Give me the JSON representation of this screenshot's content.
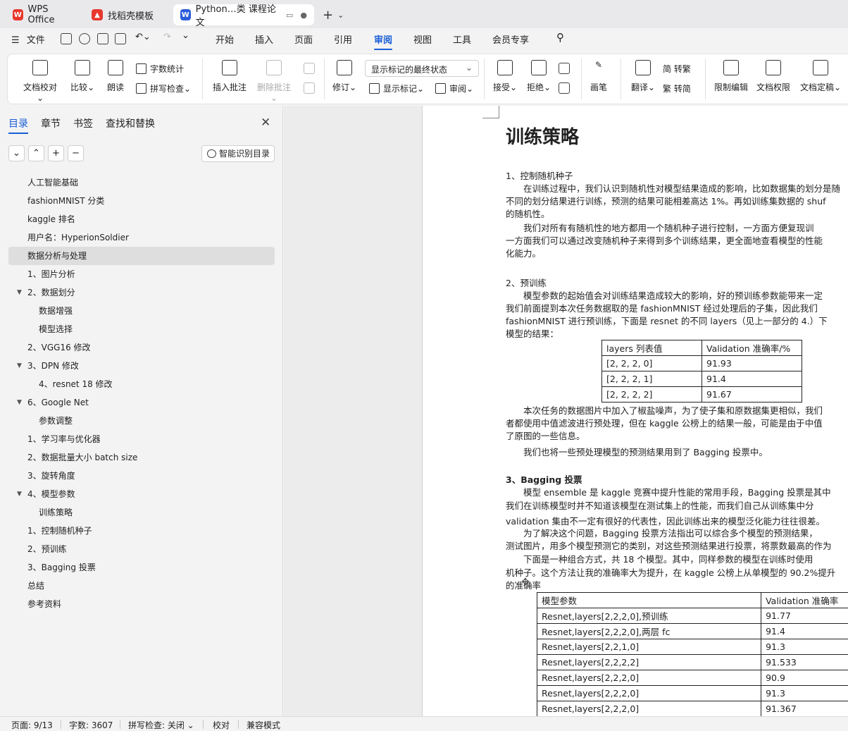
{
  "tabs": [
    {
      "label": "WPS Office",
      "icon": "wps-logo-icon",
      "color": "#e8372c"
    },
    {
      "label": "找稻壳模板",
      "icon": "docer-icon",
      "color": "#e8372c"
    },
    {
      "label": "Python…类 课程论文",
      "icon": "word-doc-icon",
      "color": "#2b5cd9"
    }
  ],
  "menu": {
    "file": "文件",
    "items": [
      "开始",
      "插入",
      "页面",
      "引用",
      "审阅",
      "视图",
      "工具",
      "会员专享"
    ],
    "active": "审阅"
  },
  "ribbon": {
    "doc_check": "文档校对",
    "compare": "比较",
    "read_aloud": "朗读",
    "word_count": "字数统计",
    "spell_check": "拼写检查",
    "insert_comment": "插入批注",
    "delete_comment": "删除批注",
    "track_changes": "修订",
    "markup_state": "显示标记的最终状态",
    "show_markup": "显示标记",
    "review": "审阅",
    "accept": "接受",
    "reject": "拒绝",
    "pen": "画笔",
    "translate": "翻译",
    "to_traditional": "简 转繁",
    "to_simplified": "繁 转简",
    "restrict_edit": "限制编辑",
    "doc_permission": "文档权限",
    "doc_finalize": "文档定稿"
  },
  "nav": {
    "tabs": [
      "目录",
      "章节",
      "书签",
      "查找和替换"
    ],
    "active_tab": "目录",
    "smart_toc": "智能识别目录",
    "toc": [
      {
        "label": "人工智能基础",
        "level": 1
      },
      {
        "label": "fashionMNIST 分类",
        "level": 1
      },
      {
        "label": "kaggle 排名",
        "level": 1
      },
      {
        "label": "用户名：HyperionSoldier",
        "level": 1
      },
      {
        "label": "数据分析与处理",
        "level": 1,
        "selected": true
      },
      {
        "label": "1、图片分析",
        "level": 1
      },
      {
        "label": "2、数据划分",
        "level": 1,
        "expanded": true
      },
      {
        "label": "数据增强",
        "level": 2
      },
      {
        "label": "模型选择",
        "level": 2
      },
      {
        "label": "2、VGG16 修改",
        "level": 1
      },
      {
        "label": "3、DPN 修改",
        "level": 1,
        "expanded": true
      },
      {
        "label": "4、resnet 18 修改",
        "level": 2
      },
      {
        "label": "6、Google Net",
        "level": 1,
        "expanded": true
      },
      {
        "label": "参数调整",
        "level": 2
      },
      {
        "label": "1、学习率与优化器",
        "level": 1
      },
      {
        "label": "2、数据批量大小 batch size",
        "level": 1
      },
      {
        "label": "3、旋转角度",
        "level": 1
      },
      {
        "label": "4、模型参数",
        "level": 1,
        "expanded": true
      },
      {
        "label": "训练策略",
        "level": 2
      },
      {
        "label": "1、控制随机种子",
        "level": 1
      },
      {
        "label": "2、预训练",
        "level": 1
      },
      {
        "label": "3、Bagging 投票",
        "level": 1
      },
      {
        "label": "总结",
        "level": 1
      },
      {
        "label": "参考资料",
        "level": 1
      }
    ]
  },
  "doc": {
    "title": "训练策略",
    "s1_head": "1、控制随机种子",
    "s1_l1": "　　在训练过程中，我们认识到随机性对模型结果造成的影响，比如数据集的划分是随",
    "s1_l2": "不同的划分结果进行训练，预测的结果可能相差高达 1%。再如训练集数据的 shuf",
    "s1_l3": "的随机性。",
    "s1_l4": "　　我们对所有有随机性的地方都用一个随机种子进行控制，一方面方便复现训",
    "s1_l5": "一方面我们可以通过改变随机种子来得到多个训练结果，更全面地查看模型的性能",
    "s1_l6": "化能力。",
    "s2_head": "2、预训练",
    "s2_l1": "　　模型参数的起始值会对训练结果造成较大的影响，好的预训练参数能带来一定",
    "s2_l2": "我们前面提到本次任务数据取的是 fashionMNIST 经过处理后的子集，因此我们",
    "s2_l3": "fashionMNIST 进行预训练，下面是 resnet 的不同 layers（见上一部分的 4.）下",
    "s2_l4": "模型的结果：",
    "t1_head": [
      "layers 列表值",
      "Validation 准确率/%"
    ],
    "t1_rows": [
      [
        "[2, 2, 2, 0]",
        "91.93"
      ],
      [
        "[2, 2, 2, 1]",
        "91.4"
      ],
      [
        "[2, 2, 2, 2]",
        "91.67"
      ]
    ],
    "s2_l5": "　　本次任务的数据图片中加入了椒盐噪声，为了使子集和原数据集更相似，我们",
    "s2_l6": "者都使用中值滤波进行预处理，但在 kaggle 公榜上的结果一般，可能是由于中值",
    "s2_l7": "了原图的一些信息。",
    "s2_l8": "　　我们也将一些预处理模型的预测结果用到了 Bagging 投票中。",
    "s3_head": "3、Bagging 投票",
    "s3_l1": "　　模型 ensemble 是 kaggle 竞赛中提升性能的常用手段，Bagging 投票是其中",
    "s3_l2": "我们在训练模型时并不知道该模型在测试集上的性能，而我们自己从训练集中分",
    "s3_l3": "validation 集由不一定有很好的代表性，因此训练出来的模型泛化能力往往很差。",
    "s3_l4": "　　为了解决这个问题，Bagging 投票方法指出可以综合多个模型的预测结果，",
    "s3_l5": "测试图片，用多个模型预测它的类别，对这些预测结果进行投票，将票数最高的作为",
    "s3_l6": "　　下面是一种组合方式，共 18 个模型。其中，同样参数的模型在训练时使用",
    "s3_l7": "机种子。这个方法让我的准确率大为提升，在 kaggle 公榜上从单模型的 90.2%提升",
    "s3_l8": "的准确率",
    "t2_head": [
      "模型参数",
      "Validation 准确率"
    ],
    "t2_rows": [
      [
        "Resnet,layers[2,2,2,0],预训练",
        "91.77"
      ],
      [
        "Resnet,layers[2,2,2,0],两层 fc",
        "91.4"
      ],
      [
        "Resnet,layers[2,2,1,0]",
        "91.3"
      ],
      [
        "Resnet,layers[2,2,2,2]",
        "91.533"
      ],
      [
        "Resnet,layers[2,2,2,0]",
        "90.9"
      ],
      [
        "Resnet,layers[2,2,2,0]",
        "91.3"
      ],
      [
        "Resnet,layers[2,2,2,0]",
        "91.367"
      ]
    ]
  },
  "status": {
    "page": "页面: 9/13",
    "words": "字数: 3607",
    "spell": "拼写检查: 关闭",
    "proof": "校对",
    "compat": "兼容模式"
  },
  "colors": {
    "accent": "#1a5fd6",
    "wps_red": "#e8372c",
    "doc_blue": "#2b5cd9"
  }
}
